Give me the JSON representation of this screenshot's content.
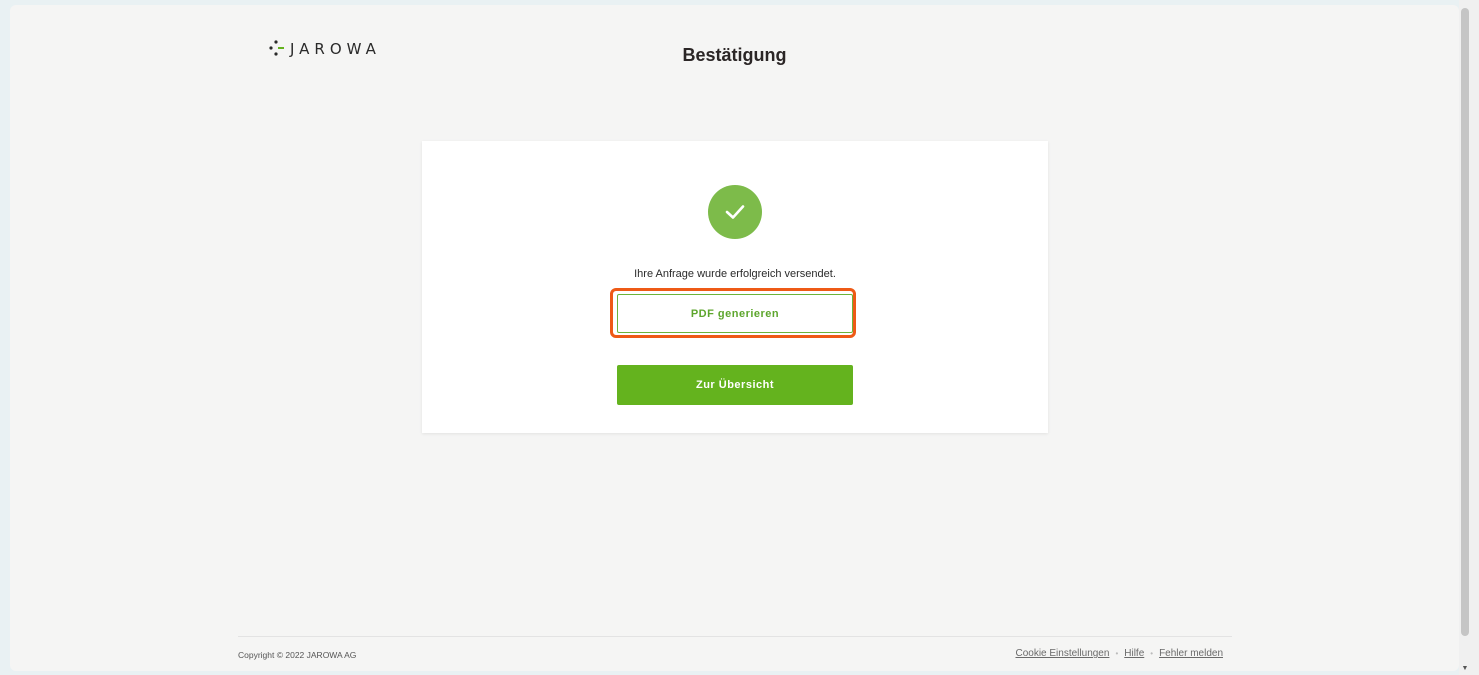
{
  "header": {
    "logo_text": "JAROWA",
    "title": "Bestätigung"
  },
  "confirmation": {
    "icon": "check-icon",
    "message": "Ihre Anfrage wurde erfolgreich versendet.",
    "pdf_button_label": "PDF generieren",
    "overview_button_label": "Zur Übersicht"
  },
  "footer": {
    "copyright": "Copyright © 2022 JAROWA AG",
    "links": {
      "cookies": "Cookie Einstellungen",
      "help": "Hilfe",
      "report": "Fehler melden"
    },
    "separator": "•"
  },
  "colors": {
    "accent_green": "#64b31e",
    "highlight_orange": "#ee5a16"
  }
}
